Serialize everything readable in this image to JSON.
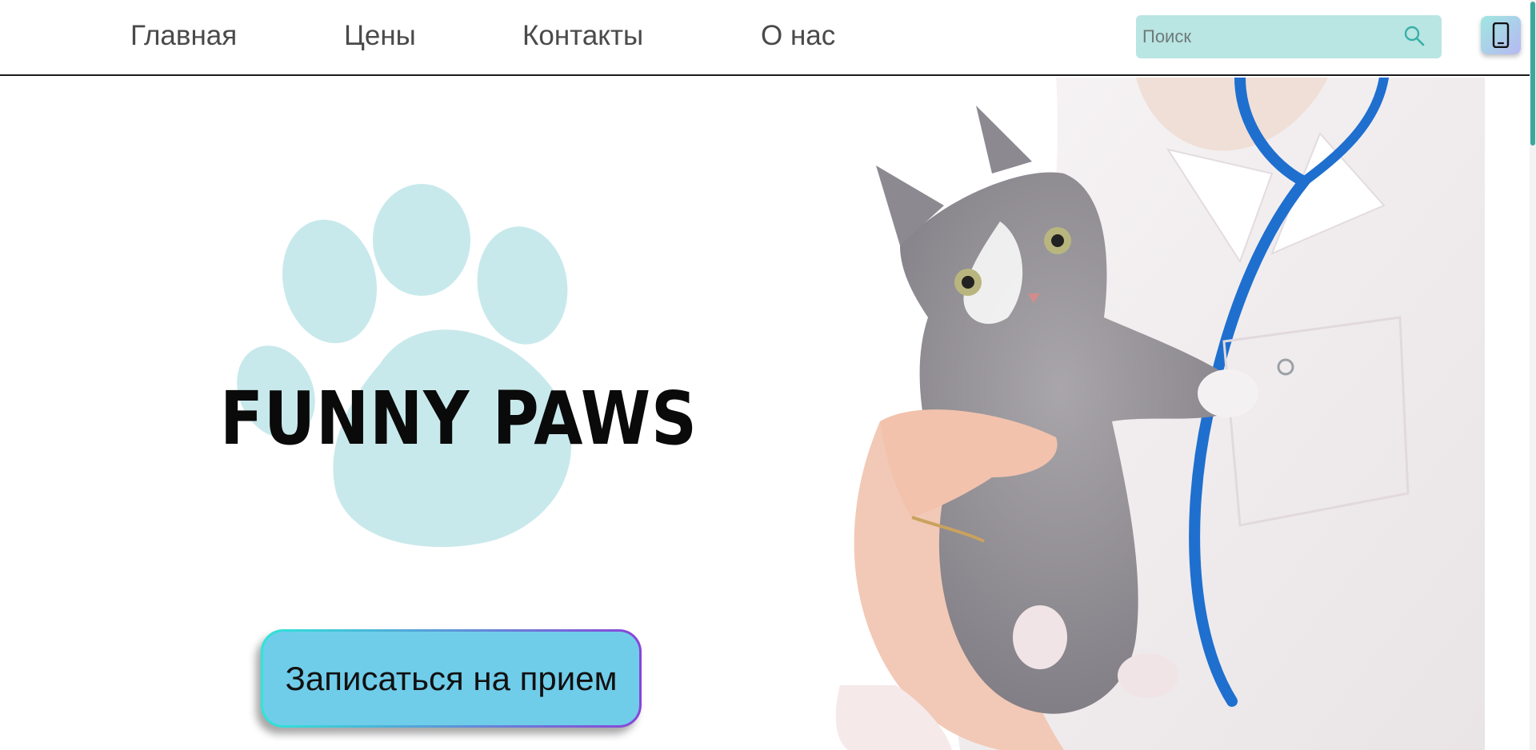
{
  "nav": {
    "items": [
      {
        "label": "Главная"
      },
      {
        "label": "Цены"
      },
      {
        "label": "Контакты"
      },
      {
        "label": "О нас"
      }
    ]
  },
  "search": {
    "placeholder": "Поиск",
    "icon": "search-icon"
  },
  "phone": {
    "icon": "phone-icon"
  },
  "hero": {
    "brand": "FUNNY PAWS",
    "cta_label": "Записаться на прием",
    "photo": "kitten-held-by-veterinarian"
  },
  "colors": {
    "search_bg": "#b9e5e2",
    "paw": "#c8e9ec",
    "cta_bg": "#70cdea",
    "scroll_thumb": "#3aa99d"
  }
}
